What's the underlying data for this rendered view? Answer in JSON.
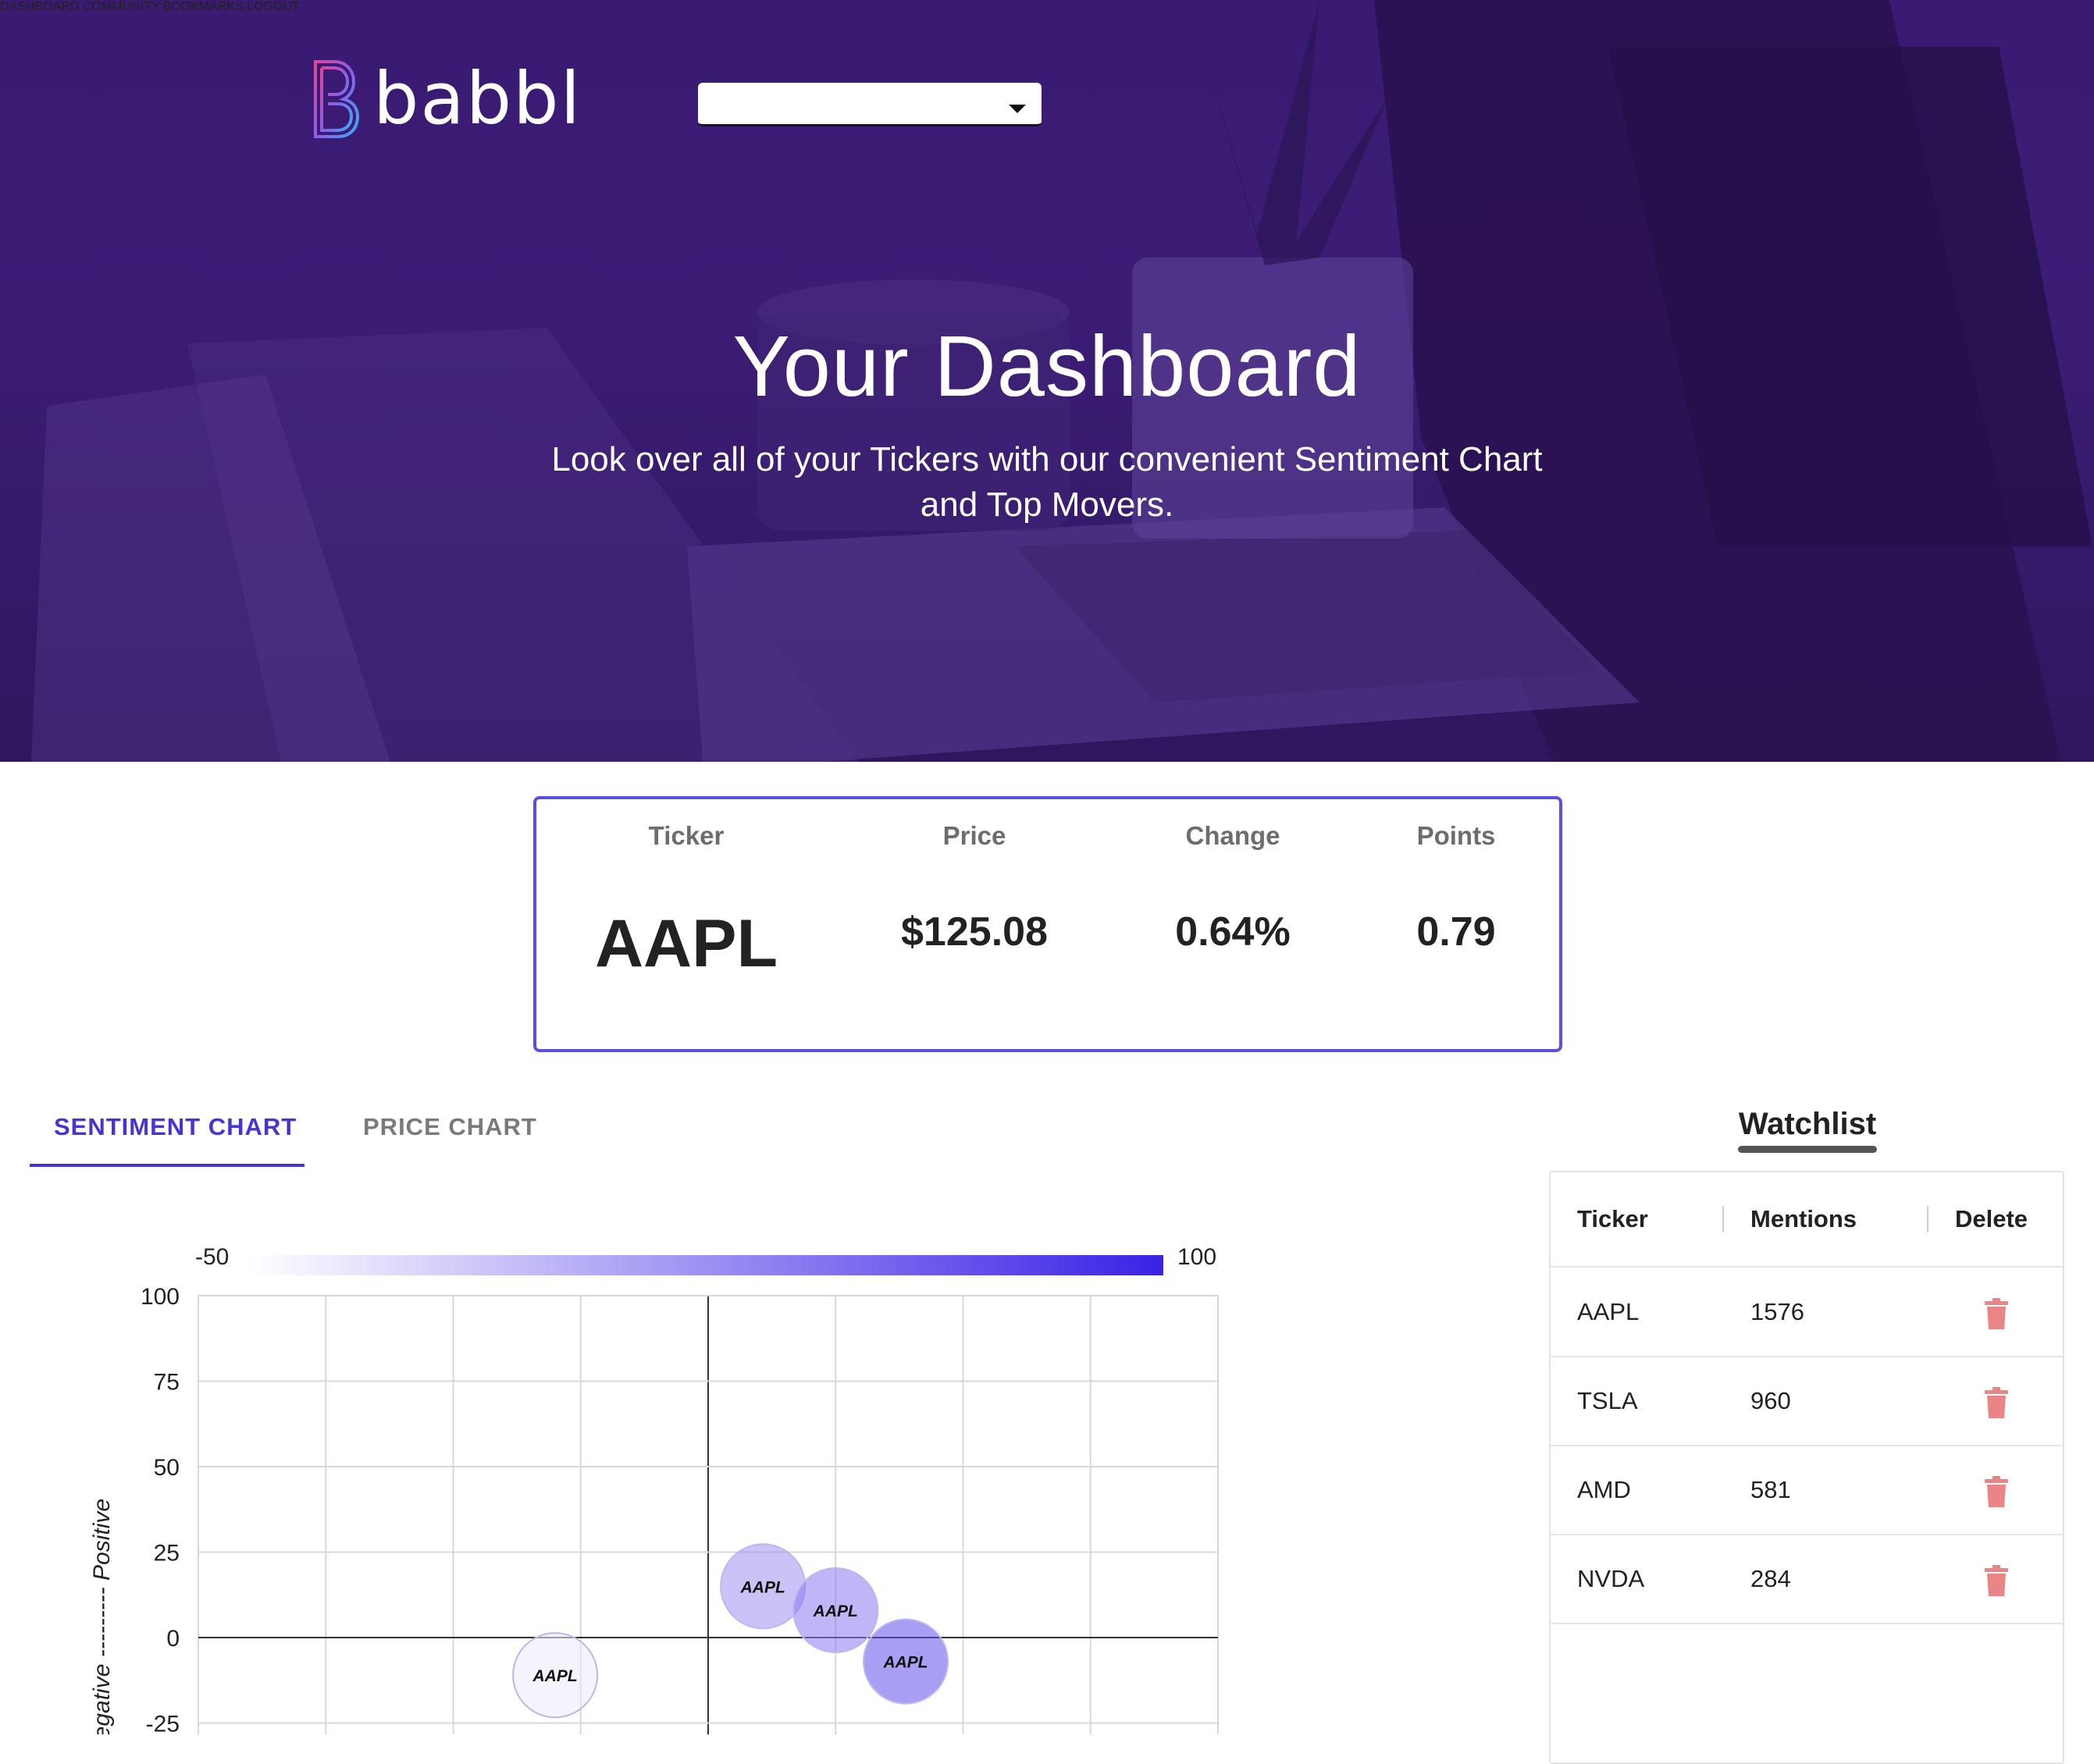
{
  "header": {
    "logo_text": "babbl",
    "nav": [
      {
        "label": "DASHBOARD"
      },
      {
        "label": "COMMUNITY"
      },
      {
        "label": "BOOKMARKS"
      },
      {
        "label": "LOGOUT"
      }
    ],
    "ticker_select_value": ""
  },
  "hero": {
    "title": "Your Dashboard",
    "subtitle_line1": "Look over all of your Tickers with our convenient Sentiment Chart",
    "subtitle_line2": "and Top Movers."
  },
  "ticker_card": {
    "headers": {
      "ticker": "Ticker",
      "price": "Price",
      "change": "Change",
      "points": "Points"
    },
    "values": {
      "ticker": "AAPL",
      "price": "$125.08",
      "change": "0.64%",
      "points": "0.79"
    },
    "border_color": "#5b4fe0"
  },
  "tabs": [
    {
      "label": "SENTIMENT CHART",
      "active": true
    },
    {
      "label": "PRICE CHART",
      "active": false
    }
  ],
  "chart_data": {
    "type": "scatter",
    "color_scale": {
      "min_label": "-50",
      "max_label": "100",
      "from": "#ffffff",
      "to": "#3a22e6"
    },
    "y_ticks": [
      "100",
      "75",
      "50",
      "25",
      "0",
      "-25"
    ],
    "ylabel": "Negative --------- Positive",
    "ylim": [
      -25,
      100
    ],
    "grid": true,
    "points": [
      {
        "label": "AAPL",
        "x": 0.43,
        "y": 15,
        "color_value": 25
      },
      {
        "label": "AAPL",
        "x": 1.0,
        "y": 8,
        "color_value": 40
      },
      {
        "label": "AAPL",
        "x": 1.55,
        "y": -7,
        "color_value": 70
      },
      {
        "label": "AAPL",
        "x": -1.2,
        "y": -11,
        "color_value": -35
      }
    ]
  },
  "watchlist": {
    "title": "Watchlist",
    "columns": [
      "Ticker",
      "Mentions",
      "Delete"
    ],
    "rows": [
      {
        "ticker": "AAPL",
        "mentions": "1576"
      },
      {
        "ticker": "TSLA",
        "mentions": "960"
      },
      {
        "ticker": "AMD",
        "mentions": "581"
      },
      {
        "ticker": "NVDA",
        "mentions": "284"
      }
    ],
    "delete_icon_color": "#e98585"
  }
}
